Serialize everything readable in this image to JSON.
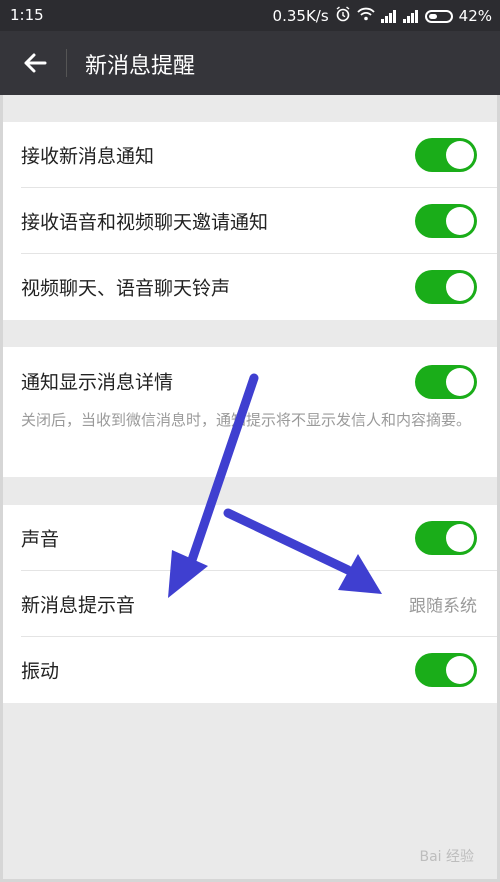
{
  "status_bar": {
    "time": "1:15",
    "network_speed": "0.35K/s",
    "battery": "42%",
    "icons": [
      "alarm-icon",
      "wifi-icon",
      "signal-icon",
      "signal-icon",
      "battery-icon"
    ]
  },
  "header": {
    "title": "新消息提醒",
    "back_icon": "back-arrow-icon"
  },
  "groups": [
    {
      "rows": [
        {
          "label": "接收新消息通知",
          "toggle": true
        },
        {
          "label": "接收语音和视频聊天邀请通知",
          "toggle": true
        },
        {
          "label": "视频聊天、语音聊天铃声",
          "toggle": true
        }
      ]
    },
    {
      "rows": [
        {
          "label": "通知显示消息详情",
          "toggle": true,
          "description": "关闭后，当收到微信消息时，通知提示将不显示发信人和内容摘要。"
        }
      ]
    },
    {
      "rows": [
        {
          "label": "声音",
          "toggle": true
        },
        {
          "label": "新消息提示音",
          "value": "跟随系统"
        },
        {
          "label": "振动",
          "toggle": true
        }
      ]
    }
  ],
  "colors": {
    "toggle_on": "#1aad19",
    "header_bg": "#35353a",
    "statusbar_bg": "#2c2c30",
    "annotation_arrow": "#3f3fd0"
  },
  "watermark": "Bai 经验"
}
